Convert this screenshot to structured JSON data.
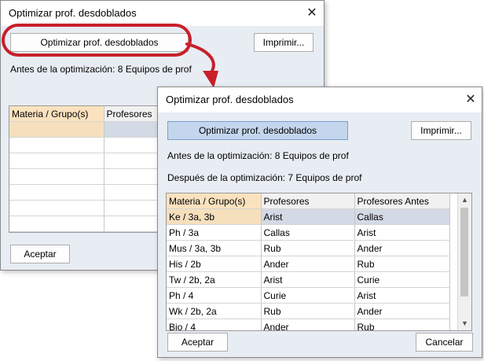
{
  "back_window": {
    "title": "Optimizar prof. desdoblados",
    "optimize_button": "Optimizar prof. desdoblados",
    "print_button": "Imprimir...",
    "before_text": "Antes de la optimización: 8 Equipos de prof",
    "table": {
      "headers": [
        "Materia / Grupo(s)",
        "Profesores"
      ]
    },
    "accept_button": "Aceptar"
  },
  "front_window": {
    "title": "Optimizar prof. desdoblados",
    "optimize_button": "Optimizar prof. desdoblados",
    "print_button": "Imprimir...",
    "before_text": "Antes de la optimización: 8 Equipos de prof",
    "after_text": "Después de la optimización: 7 Equipos de prof",
    "table": {
      "headers": [
        "Materia / Grupo(s)",
        "Profesores",
        "Profesores Antes"
      ],
      "rows": [
        [
          "Ke / 3a, 3b",
          "Arist",
          "Callas"
        ],
        [
          "Ph / 3a",
          "Callas",
          "Arist"
        ],
        [
          "Mus / 3a, 3b",
          "Rub",
          "Ander"
        ],
        [
          "His / 2b",
          "Ander",
          "Rub"
        ],
        [
          "Tw / 2b, 2a",
          "Arist",
          "Curie"
        ],
        [
          "Ph / 4",
          "Curie",
          "Arist"
        ],
        [
          "Wk / 2b, 2a",
          "Rub",
          "Ander"
        ],
        [
          "Bio / 4",
          "Ander",
          "Rub"
        ]
      ]
    },
    "accept_button": "Aceptar",
    "cancel_button": "Cancelar"
  },
  "annotation": {
    "highlight_color": "#c8202a"
  }
}
